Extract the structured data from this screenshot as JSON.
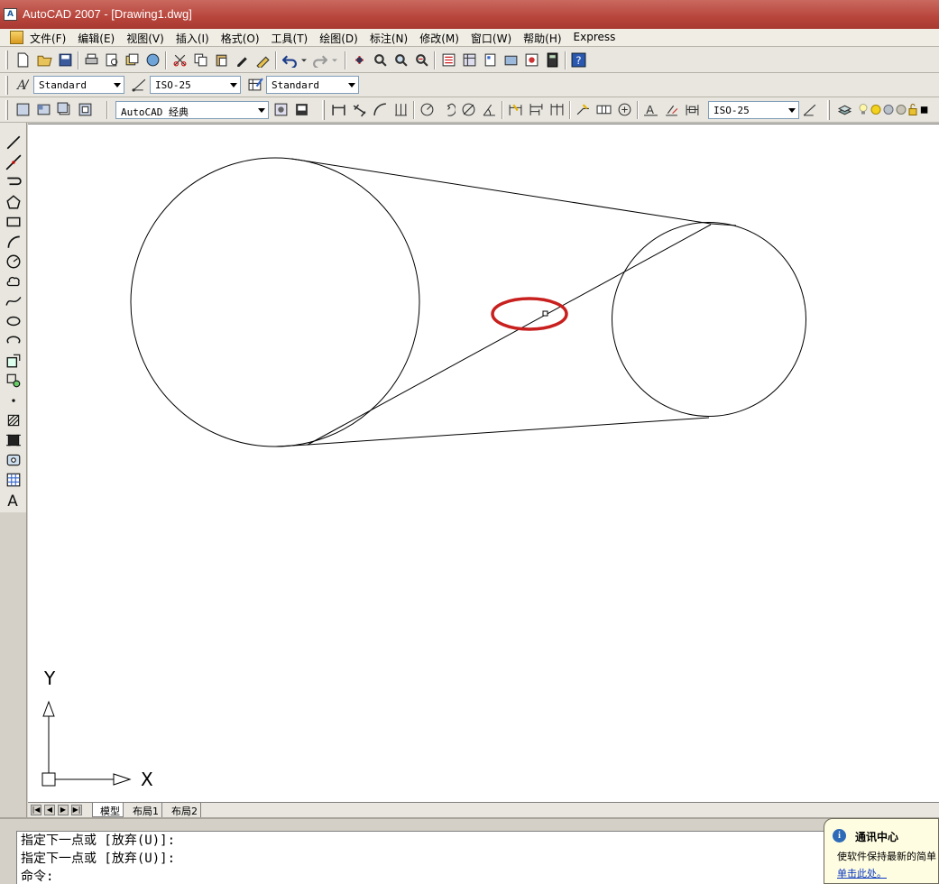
{
  "window": {
    "app_icon": "autocad-app-icon",
    "title": "AutoCAD 2007 - [Drawing1.dwg]"
  },
  "menu": {
    "items": [
      "文件(F)",
      "编辑(E)",
      "视图(V)",
      "插入(I)",
      "格式(O)",
      "工具(T)",
      "绘图(D)",
      "标注(N)",
      "修改(M)",
      "窗口(W)",
      "帮助(H)",
      "Express"
    ]
  },
  "styles_toolbar": {
    "text_style": "Standard",
    "dim_style": "ISO-25",
    "table_style": "Standard"
  },
  "workspace_toolbar": {
    "workspace": "AutoCAD 经典",
    "dim_style_current": "ISO-25"
  },
  "ucs": {
    "x_label": "X",
    "y_label": "Y"
  },
  "layout_tabs": {
    "model": "模型",
    "layout1": "布局1",
    "layout2": "布局2"
  },
  "command_line": {
    "line1": "指定下一点或 [放弃(U)]:",
    "line2": "指定下一点或 [放弃(U)]:",
    "line3": "命令:"
  },
  "comms_center": {
    "title": "通讯中心",
    "body": "使软件保持最新的简单",
    "link": "单击此处。"
  },
  "colors": {
    "title_bar": "#b8453c",
    "highlight_ellipse": "#c8201e",
    "canvas": "#ffffff"
  }
}
